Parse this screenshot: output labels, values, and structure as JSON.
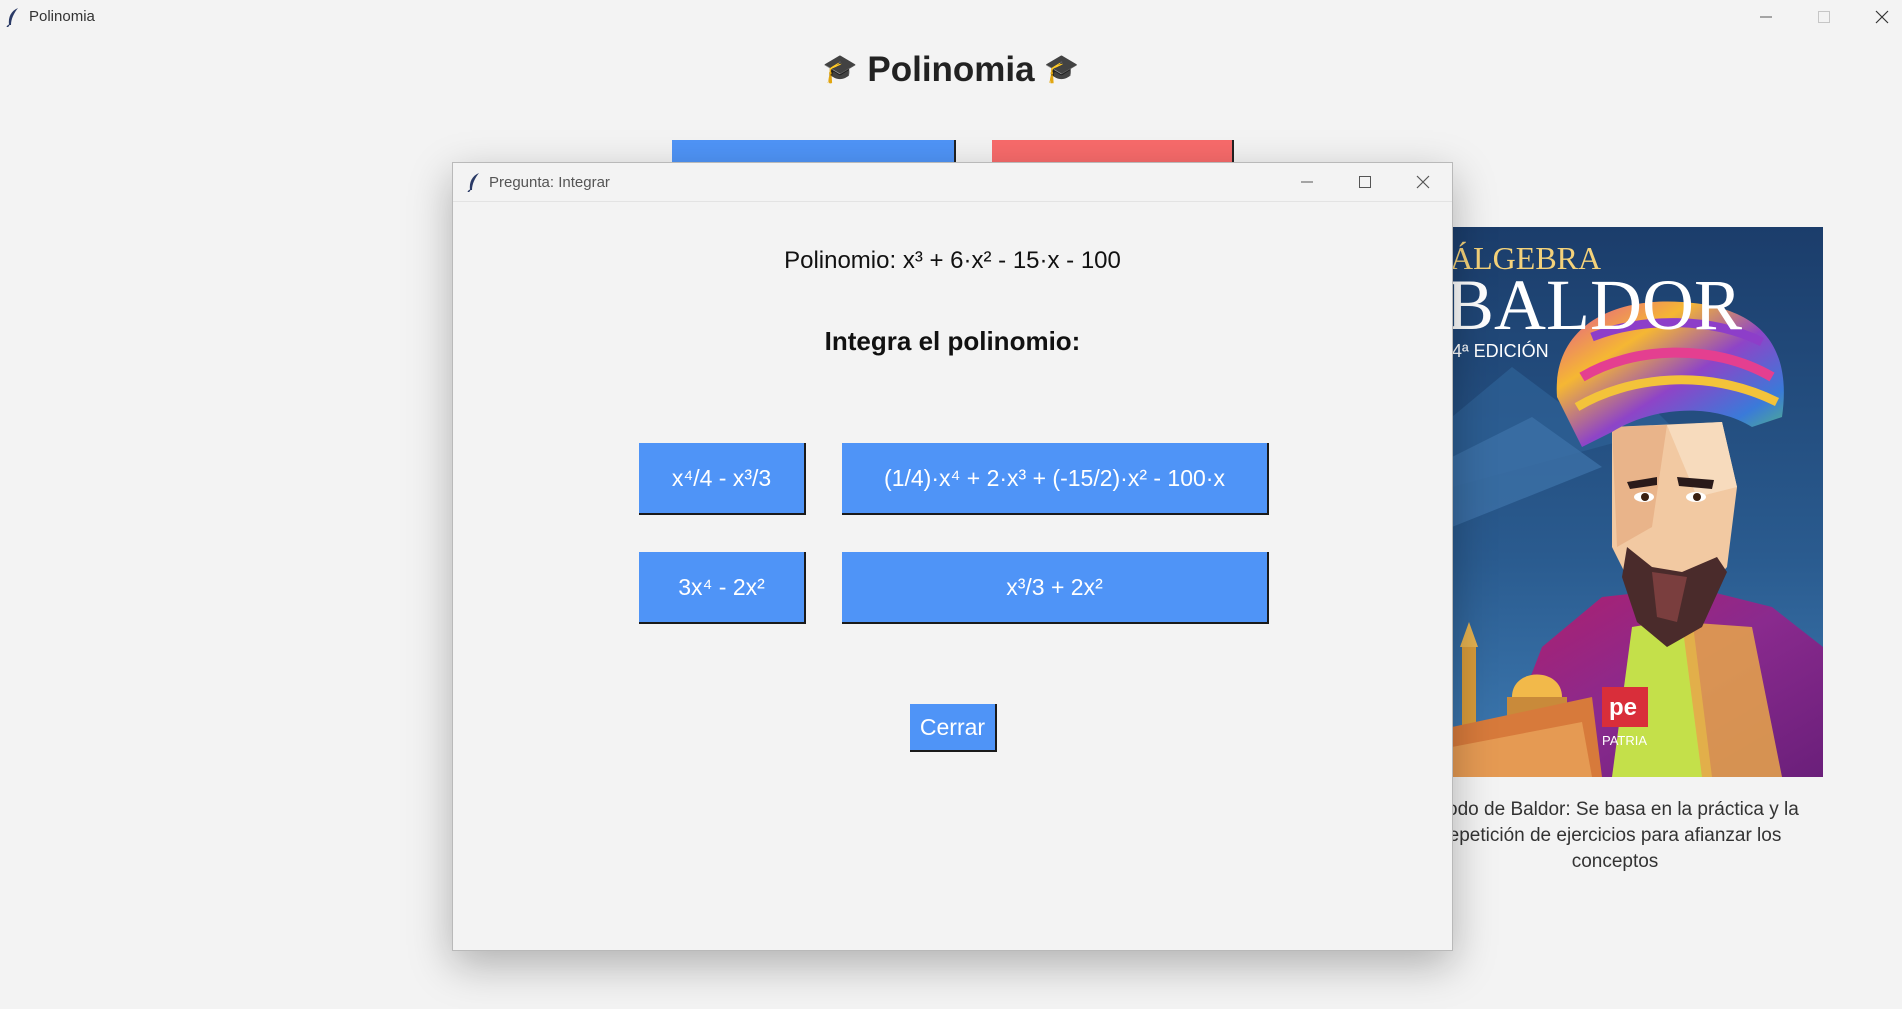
{
  "window": {
    "title": "Polinomia",
    "heading": "Polinomia",
    "heading_icon": "graduation-cap-icon"
  },
  "book": {
    "cover_title_line1": "ÁLGEBRA",
    "cover_title_line2": "BALDOR",
    "cover_edition": "4ª EDICIÓN",
    "cover_publisher": "PATRIA",
    "caption_line1": "étodo de Baldor: Se basa en la práctica y la",
    "caption_line2": "epetición de ejercicios para afianzar los",
    "caption_line3": "conceptos"
  },
  "dialog": {
    "title": "Pregunta: Integrar",
    "polynomial": "Polinomio: x³  + 6·x²  - 15·x  - 100",
    "question": "Integra el polinomio:",
    "options": [
      "x⁴/4 - x³/3",
      "(1/4)·x⁴  + 2·x³ + (-15/2)·x²  - 100·x",
      "3x⁴ - 2x²",
      "x³/3 + 2x²"
    ],
    "close_label": "Cerrar"
  },
  "colors": {
    "button_blue": "#4f94f7",
    "button_red": "#f86b6b",
    "background": "#f3f3f3"
  }
}
